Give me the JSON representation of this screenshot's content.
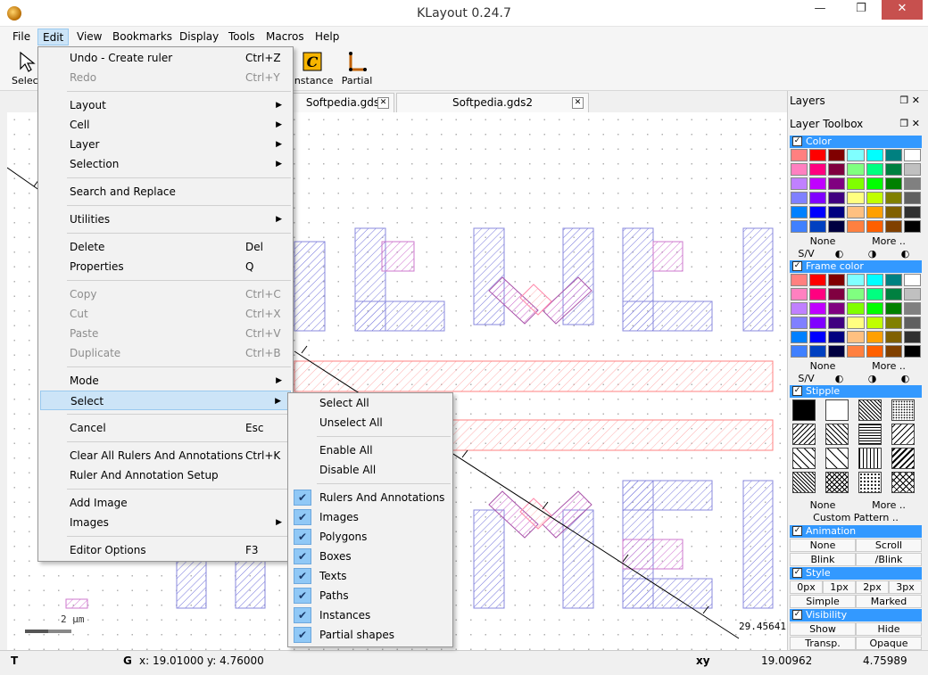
{
  "window": {
    "title": "KLayout 0.24.7",
    "min": "—",
    "max": "❐",
    "close": "✕"
  },
  "menubar": [
    "File",
    "Edit",
    "View",
    "Bookmarks",
    "Display",
    "Tools",
    "Macros",
    "Help"
  ],
  "toolbar": {
    "select": "Select",
    "instance": "Instance",
    "partial": "Partial"
  },
  "tabs": [
    {
      "label": "Softpedia.gds"
    },
    {
      "label": "Softpedia.gds2"
    }
  ],
  "edit_menu": {
    "undo": {
      "label": "Undo - Create ruler",
      "shortcut": "Ctrl+Z"
    },
    "redo": {
      "label": "Redo",
      "shortcut": "Ctrl+Y"
    },
    "layout": "Layout",
    "cell": "Cell",
    "layer": "Layer",
    "selection": "Selection",
    "search_replace": "Search and Replace",
    "utilities": "Utilities",
    "delete": {
      "label": "Delete",
      "shortcut": "Del"
    },
    "properties": {
      "label": "Properties",
      "shortcut": "Q"
    },
    "copy": {
      "label": "Copy",
      "shortcut": "Ctrl+C"
    },
    "cut": {
      "label": "Cut",
      "shortcut": "Ctrl+X"
    },
    "paste": {
      "label": "Paste",
      "shortcut": "Ctrl+V"
    },
    "duplicate": {
      "label": "Duplicate",
      "shortcut": "Ctrl+B"
    },
    "mode": "Mode",
    "select": "Select",
    "cancel": {
      "label": "Cancel",
      "shortcut": "Esc"
    },
    "clear_rulers": {
      "label": "Clear All Rulers And Annotations",
      "shortcut": "Ctrl+K"
    },
    "ruler_setup": "Ruler And Annotation Setup",
    "add_image": "Add Image",
    "images": "Images",
    "editor_options": {
      "label": "Editor Options",
      "shortcut": "F3"
    }
  },
  "select_menu": {
    "select_all": "Select All",
    "unselect_all": "Unselect All",
    "enable_all": "Enable All",
    "disable_all": "Disable All",
    "checked_items": [
      "Rulers And Annotations",
      "Images",
      "Polygons",
      "Boxes",
      "Texts",
      "Paths",
      "Instances",
      "Partial shapes"
    ]
  },
  "panel": {
    "layers": "Layers",
    "layer_toolbox": "Layer Toolbox",
    "color": "Color",
    "frame_color": "Frame color",
    "stipple": "Stipple",
    "animation": "Animation",
    "style": "Style",
    "visibility": "Visibility",
    "none": "None",
    "more": "More ..",
    "sv": "S/V",
    "custom_pattern": "Custom Pattern ..",
    "anim_none": "None",
    "anim_scroll": "Scroll",
    "anim_blink": "Blink",
    "anim_iblink": "/Blink",
    "w0": "0px",
    "w1": "1px",
    "w2": "2px",
    "w3": "3px",
    "simple": "Simple",
    "marked": "Marked",
    "show": "Show",
    "hide": "Hide",
    "transp": "Transp.",
    "opaque": "Opaque"
  },
  "palette": [
    "#ff8080",
    "#ff0000",
    "#800000",
    "#80ffff",
    "#00ffff",
    "#008080",
    "#ffffff",
    "#ff80c0",
    "#ff0080",
    "#800040",
    "#80ff80",
    "#00ff80",
    "#008040",
    "#c0c0c0",
    "#c080ff",
    "#c000ff",
    "#800080",
    "#80ff00",
    "#00ff00",
    "#008000",
    "#808080",
    "#8080ff",
    "#8000ff",
    "#400080",
    "#ffff80",
    "#c0ff00",
    "#808000",
    "#606060",
    "#0080ff",
    "#0000ff",
    "#000080",
    "#ffc080",
    "#ffa000",
    "#806000",
    "#303030",
    "#4080ff",
    "#0040c0",
    "#000040",
    "#ff8040",
    "#ff6000",
    "#804000",
    "#000000"
  ],
  "status": {
    "mode": "T",
    "grid": "G",
    "coords": "x: 19.01000  y: 4.76000",
    "xy": "xy",
    "x": "19.00962",
    "y": "4.75989"
  },
  "canvas": {
    "scale": "2 µm",
    "ruler_value": "29.45641"
  }
}
